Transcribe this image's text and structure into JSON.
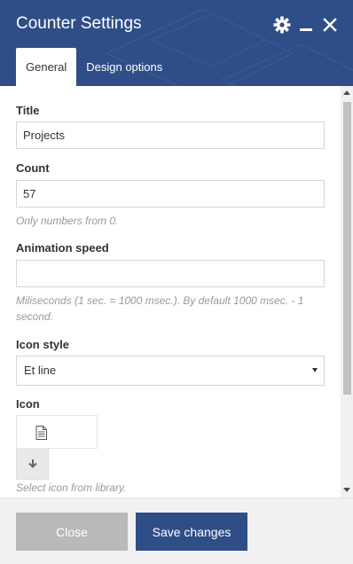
{
  "modal": {
    "title": "Counter Settings",
    "icons": {
      "settings": "gear-icon",
      "minimize": "minimize-icon",
      "close": "close-icon"
    },
    "tabs": [
      {
        "label": "General",
        "active": true
      },
      {
        "label": "Design options",
        "active": false
      }
    ]
  },
  "form": {
    "title_label": "Title",
    "title_value": "Projects",
    "count_label": "Count",
    "count_value": "57",
    "count_help": "Only numbers from 0.",
    "speed_label": "Animation speed",
    "speed_value": "",
    "speed_help": "Miliseconds (1 sec. = 1000 msec.). By default 1000 msec. - 1 second.",
    "icon_style_label": "Icon style",
    "icon_style_value": "Et line",
    "icon_label": "Icon",
    "icon_selected": "document-icon",
    "icon_help": "Select icon from library."
  },
  "footer": {
    "close_label": "Close",
    "save_label": "Save changes"
  },
  "colors": {
    "header_bg": "#2f4e88",
    "primary_button": "#2f4e88",
    "secondary_button": "#b9b9b9"
  }
}
